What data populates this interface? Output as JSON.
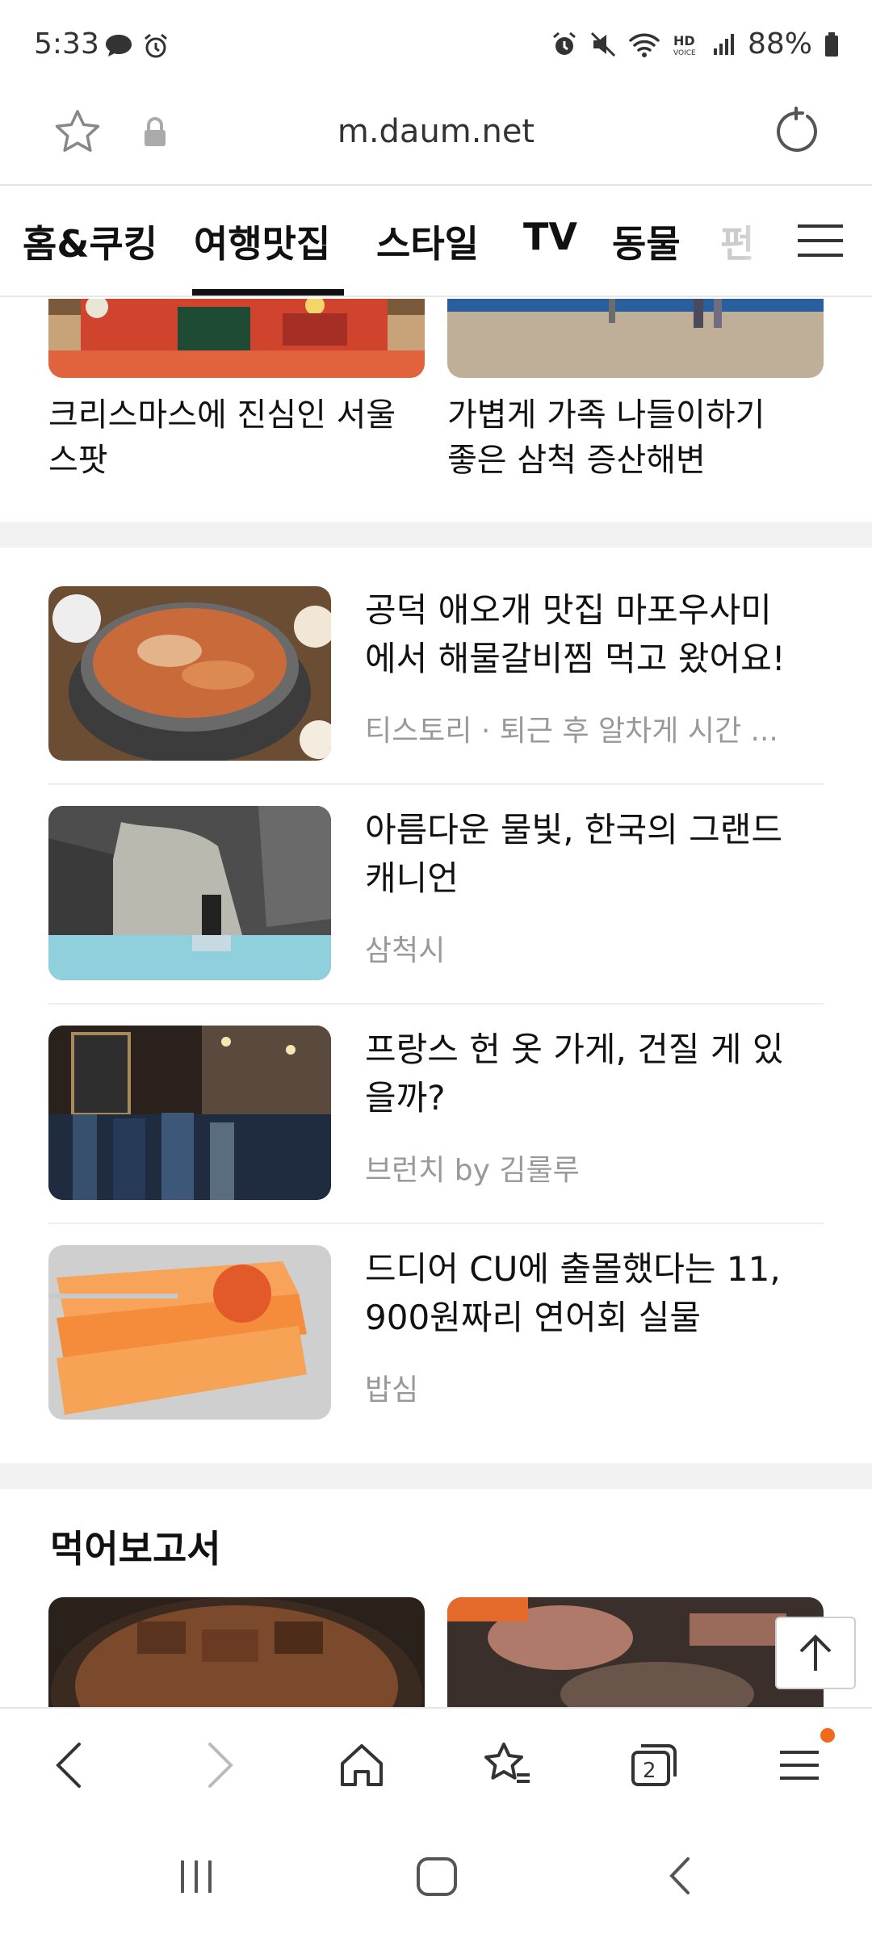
{
  "status_bar": {
    "time": "5:33",
    "battery_pct": "88%",
    "left_icons": [
      "chat-bubble-icon",
      "alarm-icon"
    ],
    "right_icons": [
      "alarm-icon",
      "mute-icon",
      "wifi-icon",
      "hd-voice-icon",
      "signal-icon",
      "battery-icon"
    ]
  },
  "url_bar": {
    "url": "m.daum.net"
  },
  "tabs": {
    "items": [
      "홈&쿠킹",
      "여행맛집",
      "스타일",
      "TV",
      "동물",
      "펀"
    ],
    "active": "여행맛집"
  },
  "top_cards": [
    {
      "title_line1": "크리스마스에 진심인 서울",
      "title_line2": "스팟"
    },
    {
      "title_line1": "가볍게 가족 나들이하기",
      "title_line2": "좋은 삼척 증산해변"
    }
  ],
  "articles": [
    {
      "title_line1": "공덕 애오개 맛집 마포우사미",
      "title_line2": "에서 해물갈비찜 먹고 왔어요!",
      "source": "티스토리 · 퇴근 후 알차게 시간 ..."
    },
    {
      "title_line1": "아름다운 물빛, 한국의 그랜드",
      "title_line2": "캐니언",
      "source": "삼척시"
    },
    {
      "title_line1": "프랑스 헌 옷 가게, 건질 게 있",
      "title_line2": "을까?",
      "source": "브런치 by 김룰루"
    },
    {
      "title_line1": "드디어 CU에 출몰했다는 11,",
      "title_line2": "900원짜리 연어회 실물",
      "source": "밥심"
    }
  ],
  "section": {
    "title": "먹어보고서"
  },
  "colors": {
    "accent_dot": "#f06a1d",
    "divider": "#f2f2f2",
    "source_text": "#999999"
  }
}
